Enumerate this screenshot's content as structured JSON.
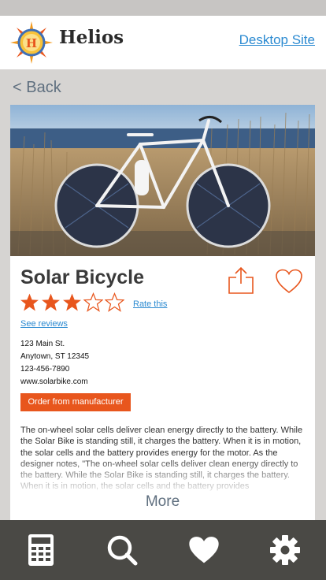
{
  "header": {
    "brand": "Helios",
    "logo_letter": "H",
    "desktop_link": "Desktop Site"
  },
  "nav": {
    "back_label": "< Back"
  },
  "product": {
    "title": "Solar Bicycle",
    "rating": 3,
    "rating_max": 5,
    "rate_link": "Rate this",
    "reviews_link": "See reviews",
    "address": {
      "street": "123 Main St.",
      "city": "Anytown, ST 12345",
      "phone": "123-456-7890",
      "website": "www.solarbike.com"
    },
    "order_button": "Order from manufacturer",
    "description": "The on-wheel solar cells deliver clean energy directly to the battery. While the Solar Bike is standing still, it charges the battery. When it is in motion, the solar cells and the battery provides energy for the motor. As the designer notes, \"The on-wheel solar cells deliver clean energy directly to the battery. While the Solar Bike is standing still, it charges the battery. When it is in motion, the solar cells and the battery provides",
    "more_label": "More"
  },
  "tabbar": {
    "icons": [
      "calculator-icon",
      "search-icon",
      "heart-icon",
      "gear-icon"
    ]
  },
  "colors": {
    "accent": "#e8561d",
    "link": "#2b8ad1",
    "tabbar": "#4a4945",
    "page_bg": "#d6d4d2"
  }
}
